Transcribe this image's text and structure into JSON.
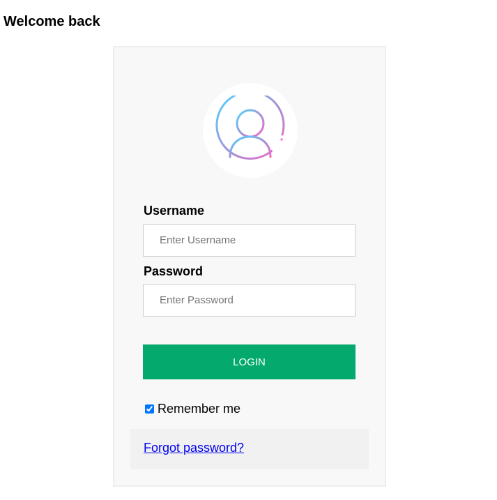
{
  "header": {
    "title": "Welcome back"
  },
  "login_form": {
    "avatar_icon": "user-circle-icon",
    "username": {
      "label": "Username",
      "placeholder": "Enter Username",
      "value": ""
    },
    "password": {
      "label": "Password",
      "placeholder": "Enter Password",
      "value": ""
    },
    "login_button_label": "LOGIN",
    "remember_me": {
      "label": "Remember me",
      "checked": true
    },
    "forgot_password_link": "Forgot password?"
  },
  "colors": {
    "login_button": "#04aa6d",
    "card_background": "#f8f8f8",
    "footer_background": "#f1f1f1",
    "link": "#0000ee",
    "avatar_gradient_start": "#4dd8ff",
    "avatar_gradient_end": "#f06bc6"
  }
}
